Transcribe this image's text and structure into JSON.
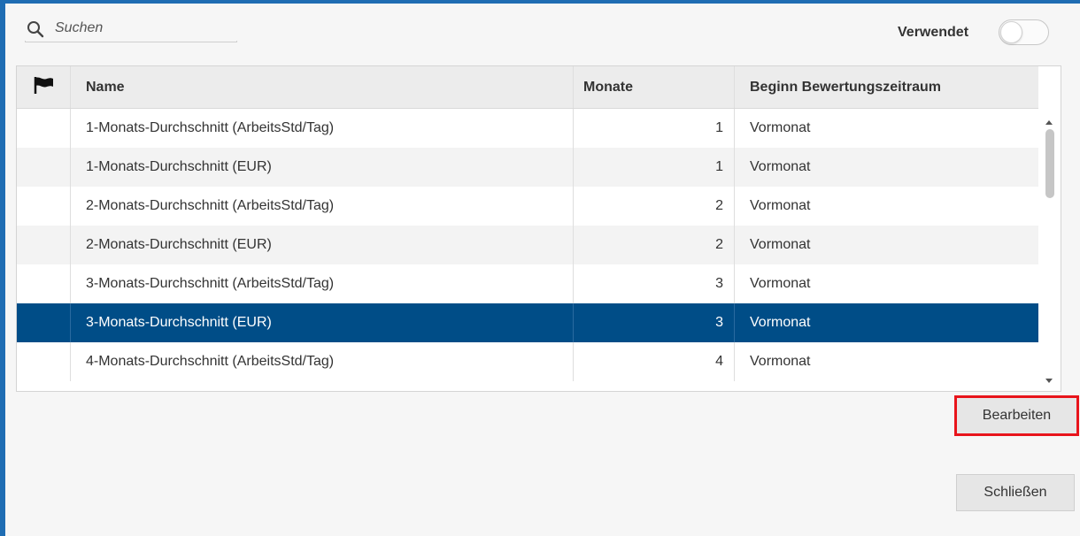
{
  "search": {
    "placeholder": "Suchen"
  },
  "used_filter": {
    "label": "Verwendet",
    "enabled": false
  },
  "table": {
    "columns": {
      "flag": "flag-icon",
      "name": "Name",
      "months": "Monate",
      "start": "Beginn Bewertungszeitraum"
    },
    "rows": [
      {
        "name": "1-Monats-Durchschnitt (ArbeitsStd/Tag)",
        "months": "1",
        "start": "Vormonat",
        "selected": false
      },
      {
        "name": "1-Monats-Durchschnitt (EUR)",
        "months": "1",
        "start": "Vormonat",
        "selected": false
      },
      {
        "name": "2-Monats-Durchschnitt (ArbeitsStd/Tag)",
        "months": "2",
        "start": "Vormonat",
        "selected": false
      },
      {
        "name": "2-Monats-Durchschnitt (EUR)",
        "months": "2",
        "start": "Vormonat",
        "selected": false
      },
      {
        "name": "3-Monats-Durchschnitt (ArbeitsStd/Tag)",
        "months": "3",
        "start": "Vormonat",
        "selected": false
      },
      {
        "name": "3-Monats-Durchschnitt (EUR)",
        "months": "3",
        "start": "Vormonat",
        "selected": true
      },
      {
        "name": "4-Monats-Durchschnitt (ArbeitsStd/Tag)",
        "months": "4",
        "start": "Vormonat",
        "selected": false
      }
    ]
  },
  "buttons": {
    "edit": "Bearbeiten",
    "close": "Schließen"
  },
  "colors": {
    "accent": "#1f6db3",
    "selected_row": "#004d87",
    "highlight_border": "#e8141b"
  }
}
